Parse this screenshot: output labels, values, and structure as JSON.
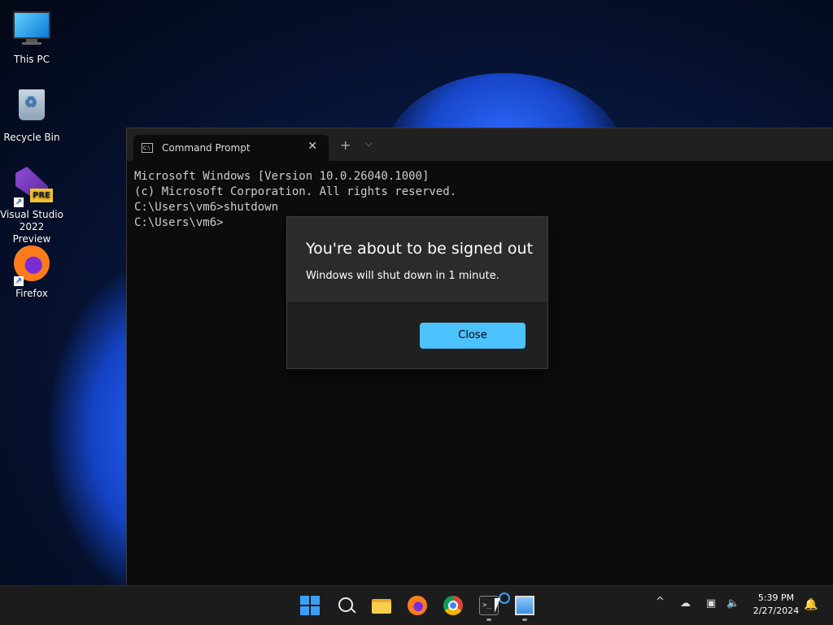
{
  "desktop": {
    "icons": [
      {
        "label": "This PC"
      },
      {
        "label": "Recycle Bin"
      },
      {
        "label": "Visual Studio\n2022 Preview",
        "line1": "Visual Studio",
        "line2": "2022 Preview",
        "badge": "PRE"
      },
      {
        "label": "Firefox"
      }
    ]
  },
  "terminal": {
    "tab_label": "Command Prompt",
    "tab_icon": "C:\\",
    "new_tab": "+",
    "dropdown": "⌵",
    "close_tab": "✕",
    "lines": [
      "Microsoft Windows [Version 10.0.26040.1000]",
      "(c) Microsoft Corporation. All rights reserved.",
      "",
      "C:\\Users\\vm6>shutdown",
      "",
      "C:\\Users\\vm6>"
    ]
  },
  "dialog": {
    "title": "You're about to be signed out",
    "message": "Windows will shut down in 1 minute.",
    "close_button": "Close"
  },
  "taskbar": {
    "terminal_icon_text": ">_",
    "tray": {
      "chevron": "^",
      "time": "5:39 PM",
      "date": "2/27/2024"
    }
  },
  "colors": {
    "accent": "#4cc2ff",
    "dialog_bg": "#2b2b2b",
    "terminal_bg": "#0c0c0c",
    "taskbar_bg": "#1c1c1c"
  }
}
